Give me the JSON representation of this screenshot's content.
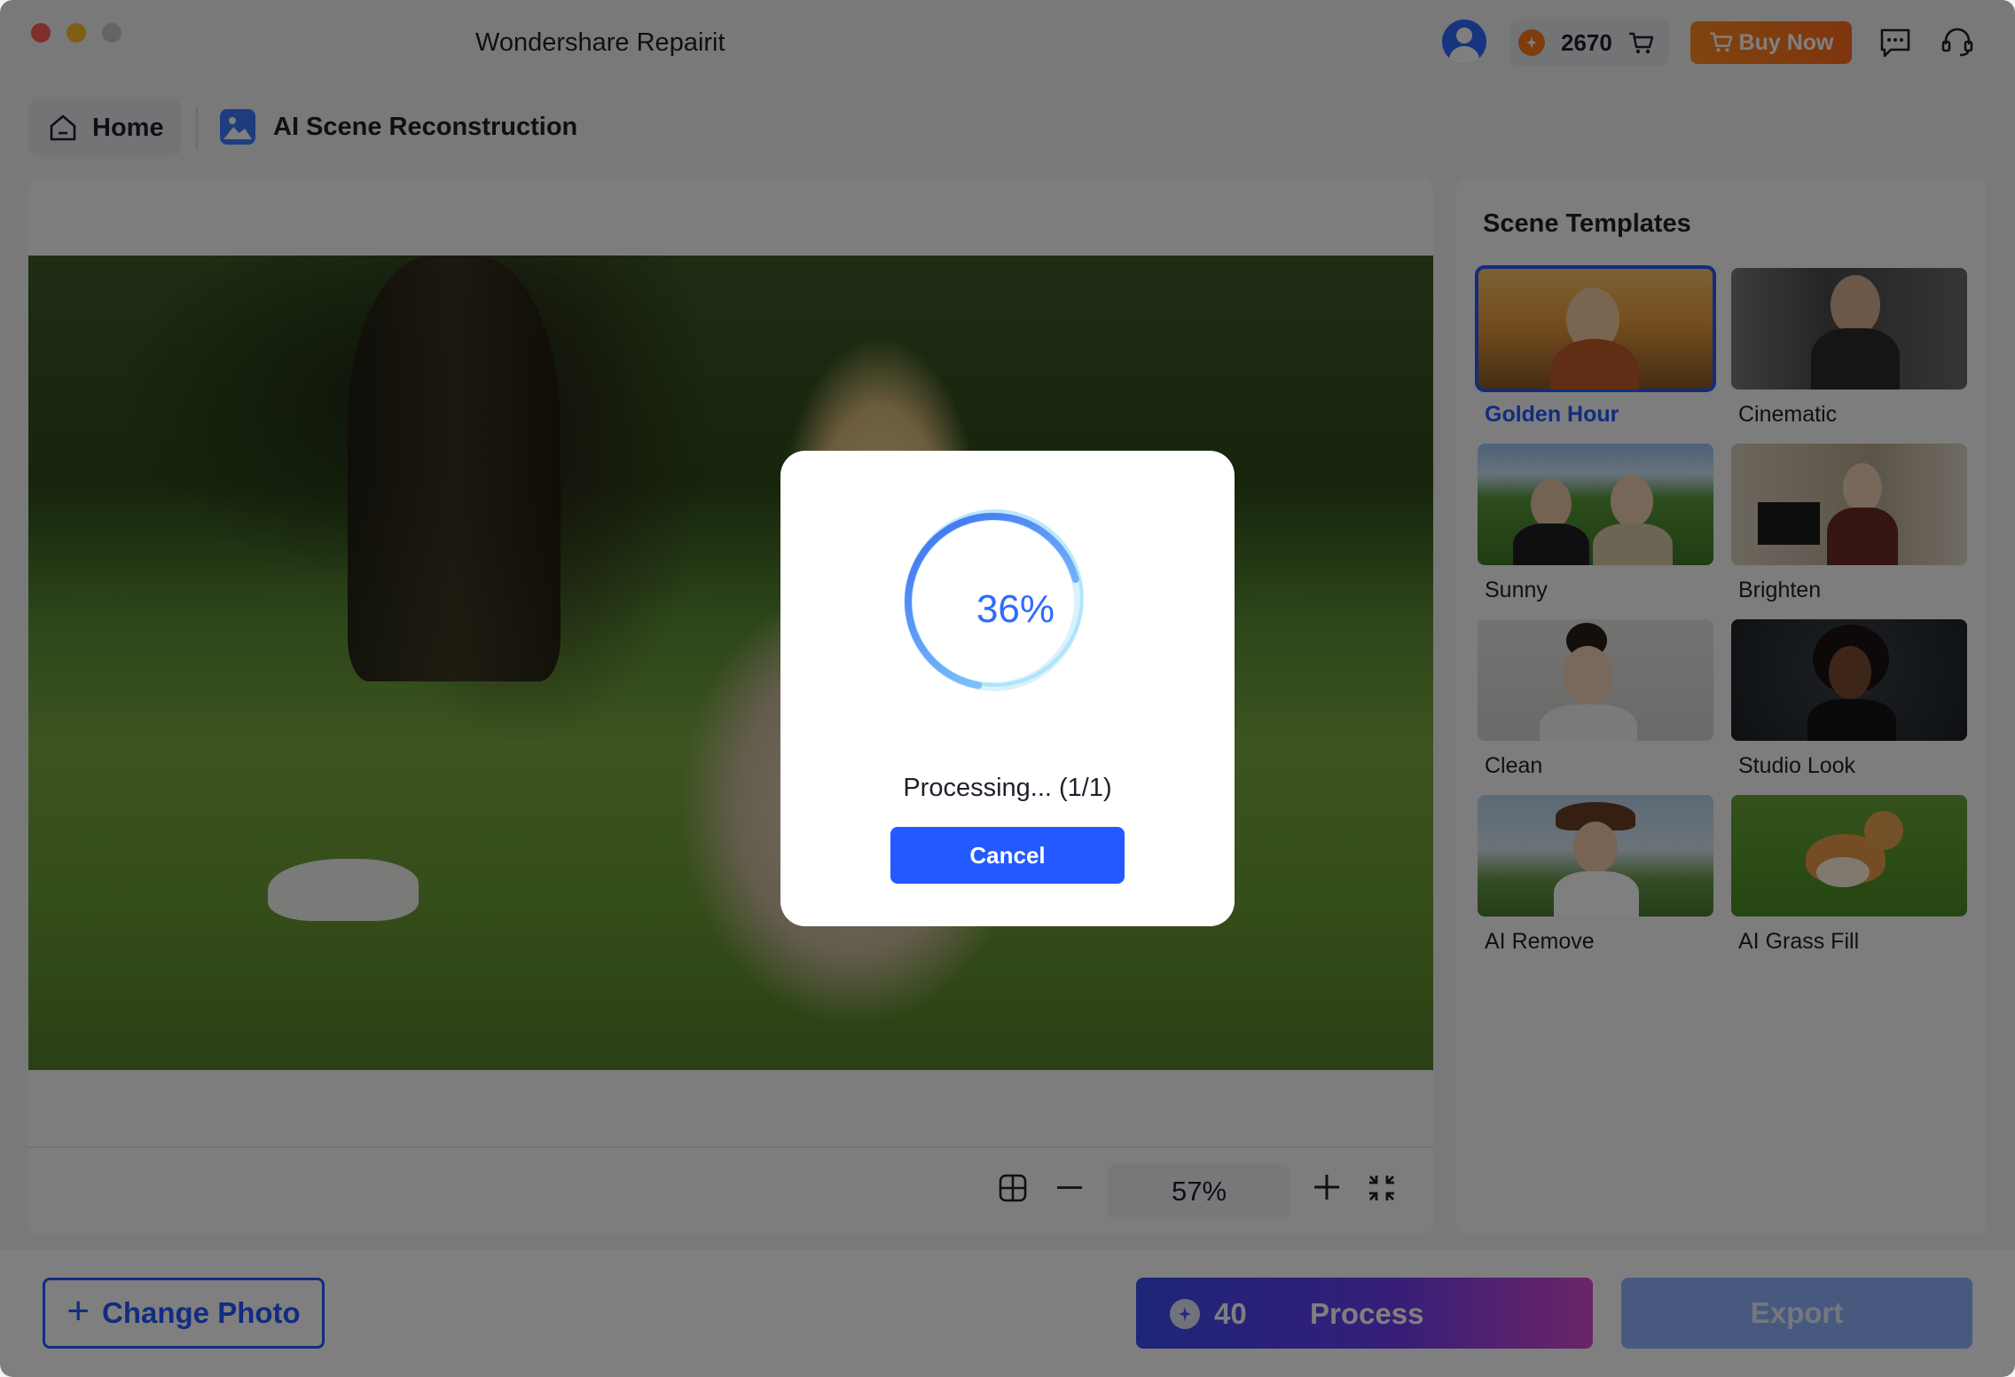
{
  "window": {
    "title": "Wondershare Repairit"
  },
  "header": {
    "credits": "2670",
    "buy_now_label": "Buy Now"
  },
  "breadcrumb": {
    "home_label": "Home",
    "current": "AI Scene Reconstruction"
  },
  "preview": {
    "zoom": "57%"
  },
  "templates": {
    "title": "Scene Templates",
    "items": [
      {
        "label": "Golden Hour",
        "selected": true
      },
      {
        "label": "Cinematic",
        "selected": false
      },
      {
        "label": "Sunny",
        "selected": false
      },
      {
        "label": "Brighten",
        "selected": false
      },
      {
        "label": "Clean",
        "selected": false
      },
      {
        "label": "Studio Look",
        "selected": false
      },
      {
        "label": "AI Remove",
        "selected": false
      },
      {
        "label": "AI Grass Fill",
        "selected": false
      }
    ]
  },
  "bottom": {
    "change_photo_label": "Change Photo",
    "process_cost": "40",
    "process_label": "Process",
    "export_label": "Export"
  },
  "dialog": {
    "progress_percent": "36%",
    "progress_value": 0.36,
    "status_text": "Processing... (1/1)",
    "cancel_label": "Cancel"
  },
  "colors": {
    "accent": "#2459ff",
    "buy_now": "#ff7a1a",
    "export_disabled": "#8fb2ff"
  },
  "icons": [
    "avatar-icon",
    "coin-icon",
    "cart-icon",
    "chat-icon",
    "headset-icon",
    "home-icon",
    "image-icon",
    "compare-icon",
    "zoom-out-icon",
    "zoom-in-icon",
    "fit-screen-icon",
    "plus-icon"
  ]
}
